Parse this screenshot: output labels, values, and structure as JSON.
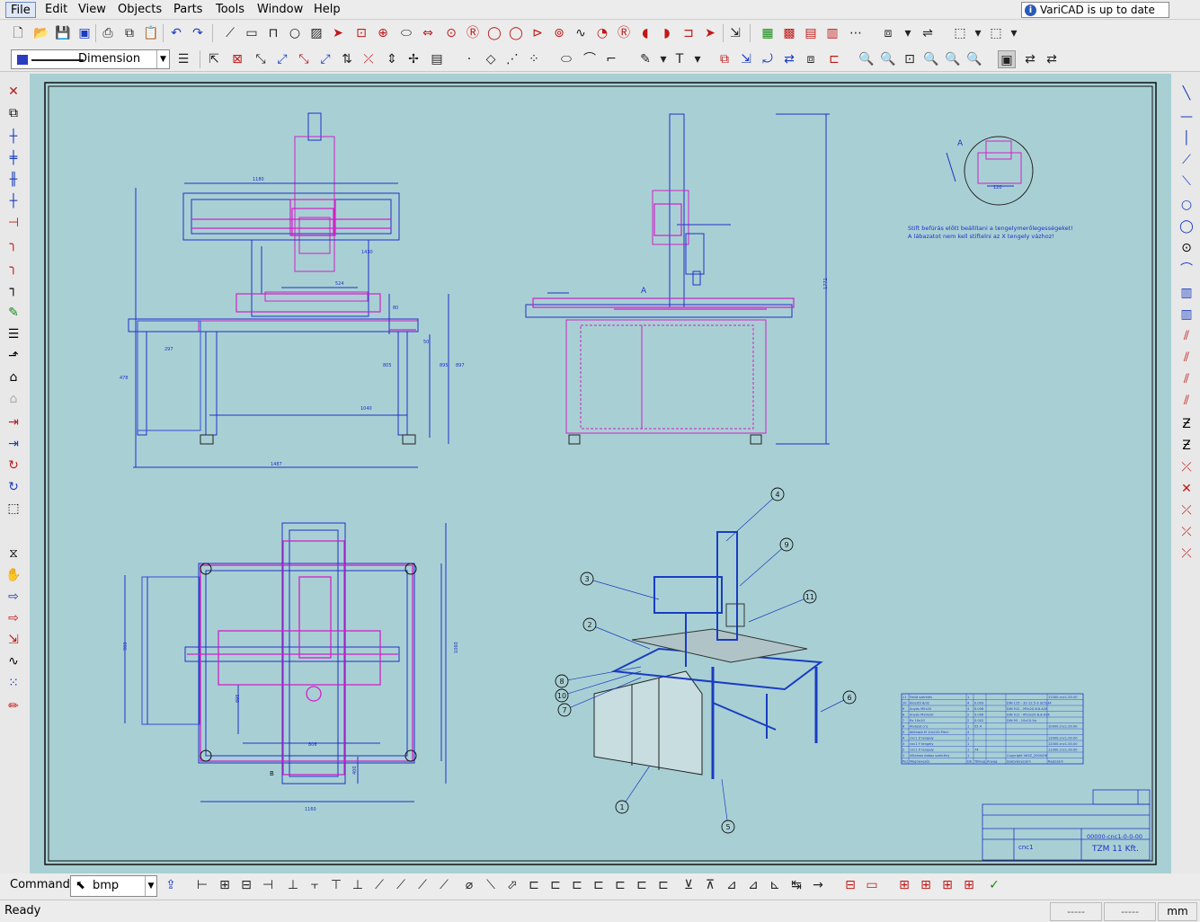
{
  "menu": {
    "items": [
      "File",
      "Edit",
      "View",
      "Objects",
      "Parts",
      "Tools",
      "Window",
      "Help"
    ]
  },
  "update_notice": "VariCAD is up to date",
  "dimension_style": {
    "label": "Dimension"
  },
  "command": {
    "label": "Command:",
    "value": "bmp"
  },
  "status": {
    "text": "Ready",
    "field1": "-----",
    "field2": "-----",
    "units": "mm"
  },
  "drawing": {
    "background": "#a8d0d4",
    "dims": {
      "top_width": "1180",
      "front_width": "1040",
      "overall_width": "1487",
      "left_height": "478",
      "h805": "805",
      "h895": "895",
      "h897": "897",
      "h80": "80",
      "w524": "524",
      "w50": "50",
      "w297": "297",
      "h1772": "1772",
      "plan_width": "1160",
      "plan_height": "1060",
      "plan_h895": "895",
      "plan_w806": "806",
      "plan_h900": "900",
      "plan_side": "400",
      "d1430": "1430"
    },
    "note_line1": "Stift befúrás előtt beállítani a tengelymerőlegességeket!",
    "note_line2": "A lábazatot nem kell stiftelni az X tengely vázhoz!",
    "detail_label": "A",
    "section_label": "B",
    "detail_dim": "120",
    "balloons": [
      "4",
      "9",
      "3",
      "11",
      "2",
      "8",
      "10",
      "7",
      "6",
      "1",
      "5"
    ],
    "bom_header": [
      "Poz.",
      "Megnevezés",
      "Db",
      "Tömeg",
      "Anyag",
      "Szabványszám",
      "Rajzszám"
    ],
    "bom_rows": [
      [
        "11",
        "Felső szerelés",
        "1",
        "",
        "",
        "",
        "11000.cnc1.00.00"
      ],
      [
        "10",
        "Elosztó 8/32",
        "4",
        "0.003",
        "",
        "DIN 125 - 32-12.5-3 St/5/34",
        ""
      ],
      [
        "9",
        "Anyás M5x20",
        "4",
        "0.006",
        "",
        "DIN 912 - M5x20-8.8-A2K",
        ""
      ],
      [
        "8",
        "Anyás M10x20",
        "2",
        "0.006",
        "",
        "DIN 912 - M10x20-8.8-A2K",
        ""
      ],
      [
        "7",
        "Rz 10x10",
        "2",
        "0.002",
        "",
        "DIN 95 - 10x10-5a",
        ""
      ],
      [
        "6",
        "Alvázat cnc",
        "1",
        "55.4",
        "",
        "",
        "10000.cnc1.00.00"
      ],
      [
        "5",
        "állítható M 10x100 Pitch",
        "4",
        "",
        "",
        "",
        ""
      ],
      [
        "4",
        "cnc1 Z tengely",
        "1",
        "",
        "",
        "",
        "13000.cnc1.00.00"
      ],
      [
        "3",
        "cnc1 Y tengely",
        "1",
        "",
        "",
        "",
        "12000.cnc1.00.00"
      ],
      [
        "2",
        "cnc1 X tengely",
        "1",
        "74",
        "",
        "",
        "11000.cnc1.00.00"
      ],
      [
        "1",
        "Villamos doboz szekrény",
        "1",
        "",
        "",
        "Copyright VASZ_2000/06",
        ""
      ]
    ],
    "title_drawing_no": "00000-cnc1-0-0-00",
    "title_name": "cnc1",
    "title_company": "TZM 11 Kft."
  }
}
